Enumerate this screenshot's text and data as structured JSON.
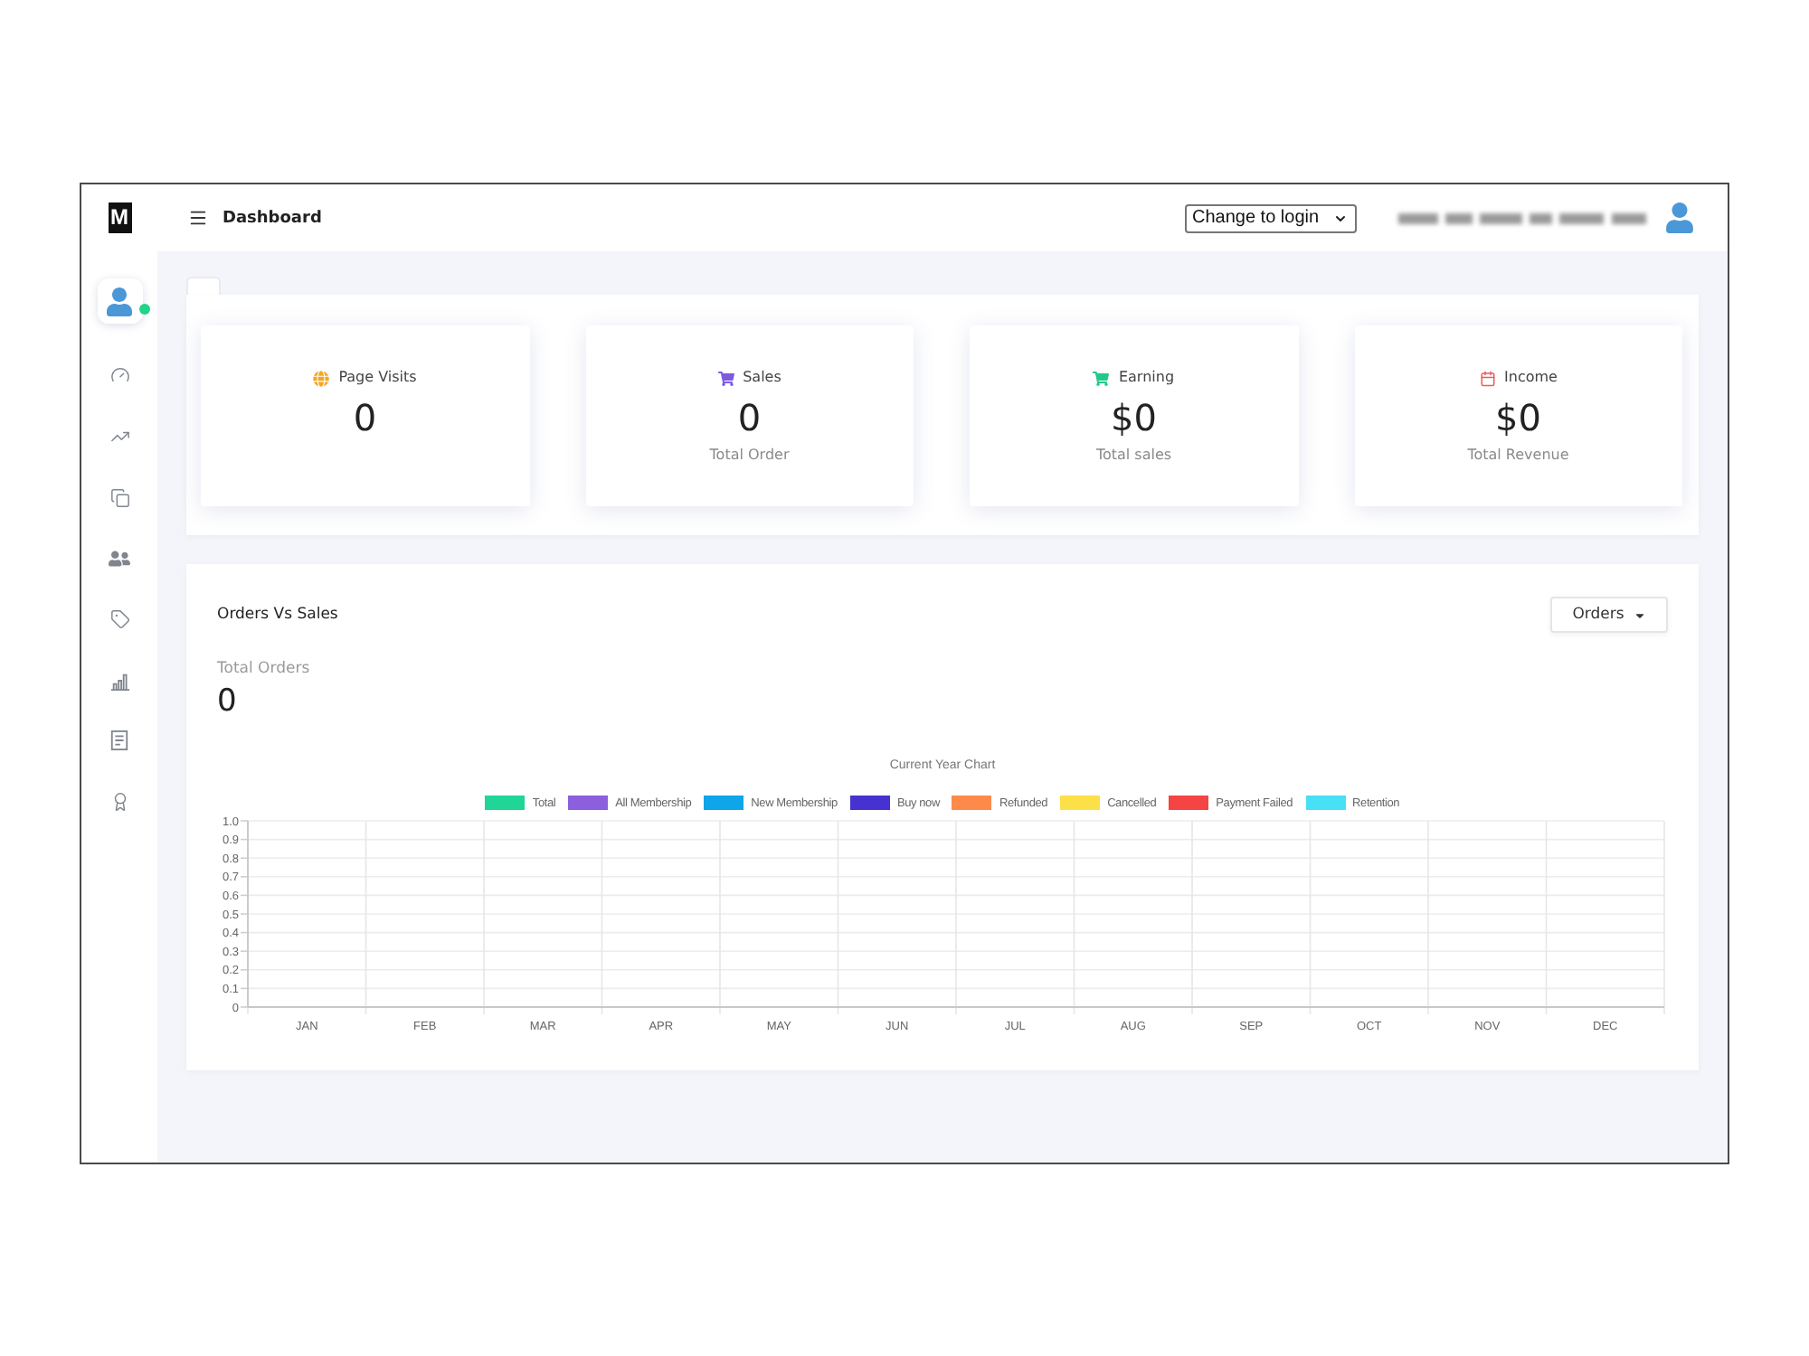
{
  "sidebar": {
    "logo": "M",
    "avatar": {
      "online": true
    }
  },
  "topbar": {
    "title": "Dashboard",
    "login_select": {
      "value": "Change to login"
    }
  },
  "stats": [
    {
      "label": "Page Visits",
      "value": "0",
      "color": "#f5a623"
    },
    {
      "label": "Sales",
      "value": "0",
      "subtitle": "Total Order",
      "color": "#7b5be0"
    },
    {
      "label": "Earning",
      "value": "$0",
      "subtitle": "Total sales",
      "color": "#22c98a"
    },
    {
      "label": "Income",
      "value": "$0",
      "subtitle": "Total Revenue",
      "color": "#ef5b57"
    }
  ],
  "orders_panel": {
    "title": "Orders Vs Sales",
    "filter_button": "Orders",
    "total_label": "Total Orders",
    "total_value": "0",
    "chart_data": [
      {
        "type": "bar",
        "title": "Current Year Chart",
        "legend": "top",
        "grid": true,
        "categories": [
          "JAN",
          "FEB",
          "MAR",
          "APR",
          "MAY",
          "JUN",
          "JUL",
          "AUG",
          "SEP",
          "OCT",
          "NOV",
          "DEC"
        ],
        "ylim": [
          0,
          1
        ],
        "yticks": [
          0,
          0.1,
          0.2,
          0.3,
          0.4,
          0.5,
          0.6,
          0.7,
          0.8,
          0.9,
          {
            "value": 1,
            "label": "1.0"
          }
        ],
        "series": [
          {
            "name": "Total",
            "color": "#20d596",
            "values": [
              null,
              null,
              null,
              null,
              null,
              null,
              null,
              null,
              null,
              null,
              null,
              null
            ]
          },
          {
            "name": "All Membership",
            "color": "#8c5fde",
            "values": [
              null,
              null,
              null,
              null,
              null,
              null,
              null,
              null,
              null,
              null,
              null,
              null
            ]
          },
          {
            "name": "New Membership",
            "color": "#0ea5e9",
            "values": [
              null,
              null,
              null,
              null,
              null,
              null,
              null,
              null,
              null,
              null,
              null,
              null
            ]
          },
          {
            "name": "Buy now",
            "color": "#4632d0",
            "values": [
              null,
              null,
              null,
              null,
              null,
              null,
              null,
              null,
              null,
              null,
              null,
              null
            ]
          },
          {
            "name": "Refunded",
            "color": "#fd8a4a",
            "values": [
              null,
              null,
              null,
              null,
              null,
              null,
              null,
              null,
              null,
              null,
              null,
              null
            ]
          },
          {
            "name": "Cancelled",
            "color": "#fde047",
            "values": [
              null,
              null,
              null,
              null,
              null,
              null,
              null,
              null,
              null,
              null,
              null,
              null
            ]
          },
          {
            "name": "Payment Failed",
            "color": "#f44444",
            "values": [
              null,
              null,
              null,
              null,
              null,
              null,
              null,
              null,
              null,
              null,
              null,
              null
            ]
          },
          {
            "name": "Retention",
            "color": "#48e0f6",
            "values": [
              null,
              null,
              null,
              null,
              null,
              null,
              null,
              null,
              null,
              null,
              null,
              null
            ]
          }
        ]
      }
    ]
  }
}
